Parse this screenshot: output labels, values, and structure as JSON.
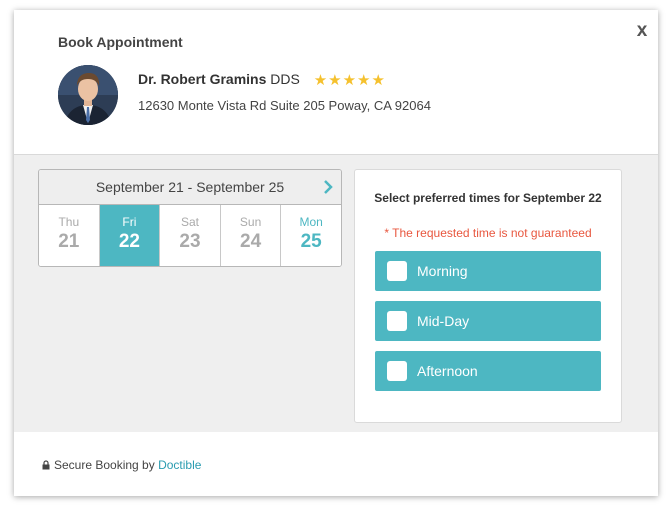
{
  "header": {
    "title": "Book Appointment",
    "close_label": "x",
    "doctor_name": "Dr. Robert Gramins",
    "doctor_suffix": "DDS",
    "rating_stars": "★★★★★",
    "rating": 5,
    "address": "12630 Monte Vista Rd Suite 205  Poway, CA 92064"
  },
  "calendar": {
    "range_label": "September 21 - September 25",
    "next_icon": "chevron-right-icon",
    "days": [
      {
        "name": "Thu",
        "date": "21"
      },
      {
        "name": "Fri",
        "date": "22"
      },
      {
        "name": "Sat",
        "date": "23"
      },
      {
        "name": "Sun",
        "date": "24"
      },
      {
        "name": "Mon",
        "date": "25"
      }
    ],
    "selected_index": 1
  },
  "times": {
    "title": "Select preferred times for September 22",
    "note": "* The requested time is not guaranteed",
    "slots": [
      {
        "label": "Morning"
      },
      {
        "label": "Mid-Day"
      },
      {
        "label": "Afternoon"
      }
    ]
  },
  "footer": {
    "secure_text": "Secure Booking by",
    "brand": "Doctible",
    "lock_icon": "lock-icon"
  },
  "colors": {
    "accent": "#4db7c2",
    "star": "#f5c12e",
    "warning": "#e8573f",
    "brand_link": "#2a9cb0"
  }
}
